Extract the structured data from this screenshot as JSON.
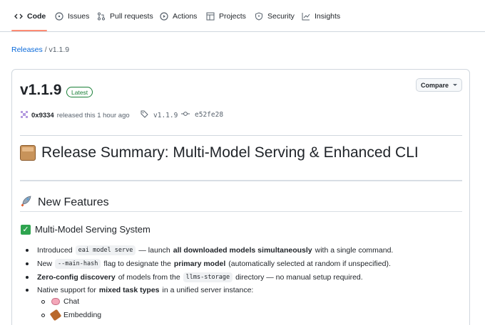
{
  "nav": {
    "tabs": [
      {
        "label": "Code",
        "icon": "code-icon"
      },
      {
        "label": "Issues",
        "icon": "issue-icon"
      },
      {
        "label": "Pull requests",
        "icon": "pull-request-icon"
      },
      {
        "label": "Actions",
        "icon": "play-icon"
      },
      {
        "label": "Projects",
        "icon": "table-icon"
      },
      {
        "label": "Security",
        "icon": "shield-icon"
      },
      {
        "label": "Insights",
        "icon": "graph-icon"
      }
    ],
    "active_tab": "Code"
  },
  "breadcrumb": {
    "releases": "Releases",
    "separator": "/",
    "current": "v1.1.9"
  },
  "release": {
    "version": "v1.1.9",
    "badge": "Latest",
    "compare_label": "Compare",
    "author": "0x9334",
    "released_text": "released this 1 hour ago",
    "tag": "v1.1.9",
    "commit": "e52fe28"
  },
  "notes": {
    "summary_title": "Release Summary: Multi-Model Serving & Enhanced CLI",
    "section_title": "New Features",
    "subsection_title": "Multi-Model Serving System",
    "bullets": [
      {
        "pre": "Introduced",
        "code": "eai model serve",
        "mid": "— launch",
        "bold": "all downloaded models simultaneously",
        "post": "with a single command."
      },
      {
        "pre": "New",
        "code": "--main-hash",
        "mid": "flag to designate the",
        "bold": "primary model",
        "post": "(automatically selected at random if unspecified)."
      },
      {
        "bold": "Zero-config discovery",
        "mid": "of models from the",
        "code": "llms-storage",
        "post": "directory — no manual setup required."
      },
      {
        "pre": "Native support for",
        "bold": "mixed task types",
        "post": "in a unified server instance:"
      }
    ],
    "sub_bullets": [
      "Chat",
      "Embedding"
    ]
  },
  "colors": {
    "link": "#0969da",
    "active_underline": "#fd8c73",
    "badge_green": "#1a7f37",
    "border": "#d0d7de"
  }
}
